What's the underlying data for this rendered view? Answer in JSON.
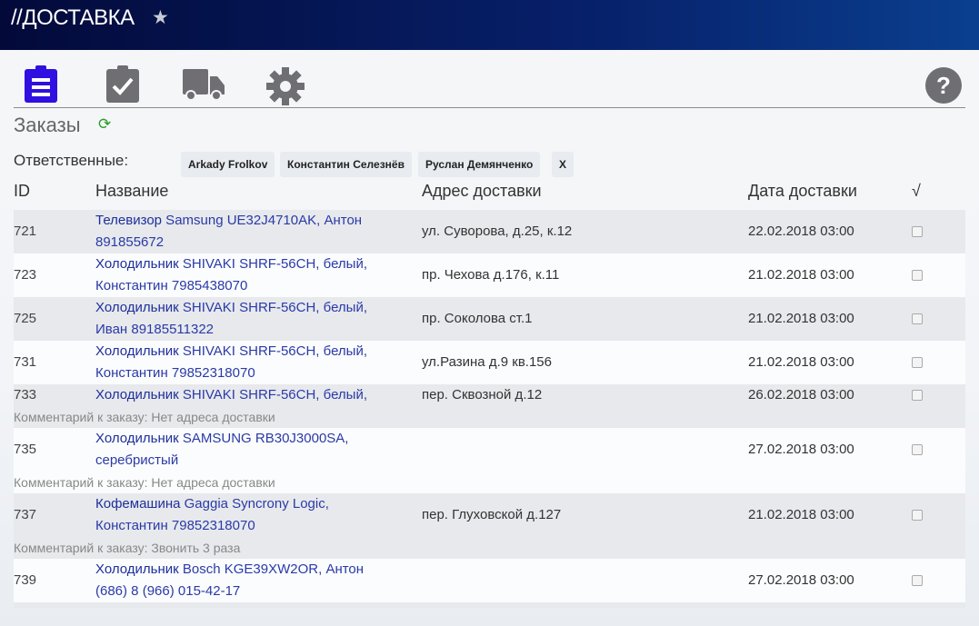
{
  "header": {
    "title": "//ДОСТАВКА"
  },
  "section": {
    "title": "Заказы",
    "responsible_label": "Ответственные:",
    "chips": [
      "Arkady Frolkov",
      "Константин Селезнёв",
      "Руслан Демянченко",
      "X"
    ]
  },
  "columns": [
    "ID",
    "Название",
    "Адрес доставки",
    "Дата доставки",
    "√"
  ],
  "comment_prefix": "Комментарий к заказу:",
  "orders": [
    {
      "id": "721",
      "category": "Телевизор",
      "name1": " Samsung UE32J4710AK, Антон",
      "name2": "891855672",
      "address": "ул. Суворова, д.25, к.12",
      "date": "22.02.2018 03:00"
    },
    {
      "id": "723",
      "category": "Холодильник",
      "name1": " SHIVAKI SHRF-56CH, белый,",
      "name2": "Константин 7985438070",
      "address": "пр. Чехова д.176, к.11",
      "date": "21.02.2018 03:00"
    },
    {
      "id": "725",
      "category": "Холодильник",
      "name1": " SHIVAKI SHRF-56CH, белый,",
      "name2": "Иван 89185511322",
      "address": "пр. Соколова ст.1",
      "date": "21.02.2018 03:00"
    },
    {
      "id": "731",
      "category": "Холодильник",
      "name1": " SHIVAKI SHRF-56CH, белый,",
      "name2": "Константин 79852318070",
      "address": "ул.Разина д.9 кв.156",
      "date": "21.02.2018 03:00"
    },
    {
      "id": "733",
      "category": "Холодильник",
      "name1": " SHIVAKI SHRF-56CH, белый,",
      "name2": "",
      "address": "пер. Сквозной д.12",
      "date": "26.02.2018 03:00",
      "comment": "Комментарий к заказу: Нет адреса доставки"
    },
    {
      "id": "735",
      "category": "Холодильник",
      "name1": " SAMSUNG RB30J3000SA,",
      "name2": "серебристый",
      "address": "",
      "date": "27.02.2018 03:00",
      "comment": "Комментарий к заказу: Нет адреса доставки"
    },
    {
      "id": "737",
      "category": "Кофемашина",
      "name1": " Gaggia Syncrony Logic,",
      "name2": "Константин 79852318070",
      "address": "пер. Глуховской д.127",
      "date": "21.02.2018 03:00",
      "comment": "Комментарий к заказу: Звонить 3 раза"
    },
    {
      "id": "739",
      "category": "Холодильник",
      "name1": " Bosch KGE39XW2OR, Антон",
      "name2": "(686) 8 (966) 015-42-17",
      "address": "",
      "date": "27.02.2018 03:00"
    }
  ]
}
